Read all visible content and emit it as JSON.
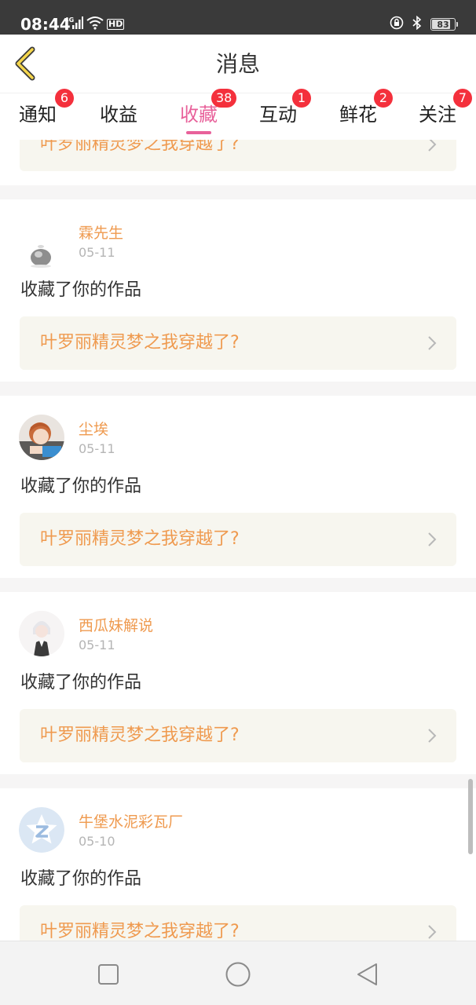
{
  "status_bar": {
    "time": "08:44",
    "network": "4G",
    "hd": "HD",
    "battery": 83,
    "icons": [
      "signal-icon",
      "wifi-icon",
      "hd-icon",
      "lock-rotation-icon",
      "bluetooth-icon",
      "battery-icon"
    ]
  },
  "header": {
    "title": "消息",
    "back_icon": "chevron-left-icon"
  },
  "tabs": [
    {
      "label": "通知",
      "badge": "6"
    },
    {
      "label": "收益",
      "badge": ""
    },
    {
      "label": "收藏",
      "badge": "38",
      "active": true
    },
    {
      "label": "互动",
      "badge": "1"
    },
    {
      "label": "鲜花",
      "badge": "2"
    },
    {
      "label": "关注",
      "badge": "7"
    }
  ],
  "colors": {
    "accent": "#e8619a",
    "badge": "#f4303c",
    "orange_text": "#ef9a4f",
    "work_box_bg": "#f7f6ef",
    "divider_bg": "#f6f5f5"
  },
  "items": [
    {
      "work_title": "叶罗丽精灵梦之我穿越了?"
    },
    {
      "user": "霖先生",
      "date": "05-11",
      "message": "收藏了你的作品",
      "work_title": "叶罗丽精灵梦之我穿越了?",
      "avatar": "grey-creature-avatar"
    },
    {
      "user": "尘埃",
      "date": "05-11",
      "message": "收藏了你的作品",
      "work_title": "叶罗丽精灵梦之我穿越了?",
      "avatar": "anime-girl-avatar"
    },
    {
      "user": "西瓜妹解说",
      "date": "05-11",
      "message": "收藏了你的作品",
      "work_title": "叶罗丽精灵梦之我穿越了?",
      "avatar": "anime-boy-avatar"
    },
    {
      "user": "牛堡水泥彩瓦厂",
      "date": "05-10",
      "message": "收藏了你的作品",
      "work_title": "叶罗丽精灵梦之我穿越了?",
      "avatar": "default-z-avatar"
    }
  ],
  "nav_bar": {
    "buttons": [
      "recent-apps-icon",
      "home-icon",
      "back-triangle-icon"
    ]
  }
}
